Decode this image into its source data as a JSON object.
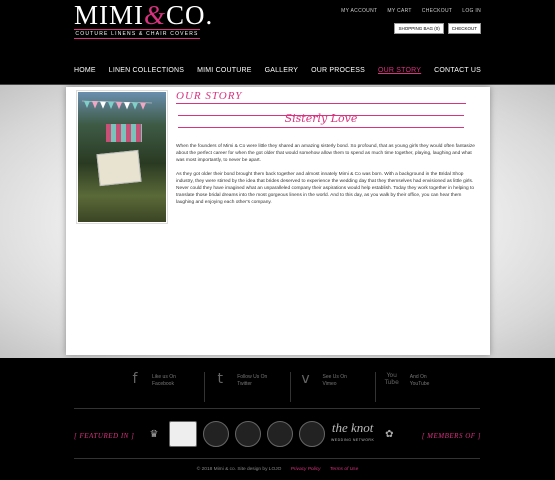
{
  "brand": {
    "name_left": "MIMI",
    "name_amp": "&",
    "name_right": "CO.",
    "tagline": "COUTURE LINENS & CHAIR COVERS"
  },
  "top_links": [
    "MY ACCOUNT",
    "MY CART",
    "CHECKOUT",
    "LOG IN"
  ],
  "cart": {
    "shopping_bag": "SHOPPING BAG (0)",
    "checkout": "CHECKOUT"
  },
  "nav": [
    {
      "label": "HOME",
      "active": false
    },
    {
      "label": "LINEN COLLECTIONS",
      "active": false
    },
    {
      "label": "MIMI COUTURE",
      "active": false
    },
    {
      "label": "GALLERY",
      "active": false
    },
    {
      "label": "OUR PROCESS",
      "active": false
    },
    {
      "label": "OUR STORY",
      "active": true
    },
    {
      "label": "CONTACT US",
      "active": false
    }
  ],
  "page": {
    "title": "OUR STORY",
    "banner": "Sisterly Love",
    "paragraphs": [
      "When the founders of Mimi & Co were little they shared an amazing sisterly bond. So profound, that as young girls they would often fantasize about the perfect career for when the got older that would somehow allow them to spend as much time together, playing, laughing and what was most importantly, to never be apart.",
      "As they got older their bond brought them back together and almost innately Mimi & Co was born. With a background in the Bridal Shop industry, they were stirred by the idea that brides deserved to experience the wedding day that they themselves had envisioned as little girls. Never could they have imagined what an unparalleled company their aspirations would help establish. Today they work together in helping to translate those bridal dreams into the most gorgeous linens in the world. And to this day, as you walk by their office, you can hear them laughing and enjoying each other's company."
    ]
  },
  "social": [
    {
      "icon": "facebook-icon",
      "glyph": "f",
      "line1": "Like us On",
      "line2": "Facebook"
    },
    {
      "icon": "twitter-icon",
      "glyph": "t",
      "line1": "Follow Us On",
      "line2": "Twitter"
    },
    {
      "icon": "vimeo-icon",
      "glyph": "v",
      "line1": "See Us On",
      "line2": "Vimeo"
    },
    {
      "icon": "youtube-icon",
      "glyph": "You Tube",
      "line1": "And On",
      "line2": "YouTube"
    }
  ],
  "footer": {
    "featured_in": "[ FEATURED IN ]",
    "members_of": "[ MEMBERS OF ]",
    "knot": "the knot",
    "knot_sub": "WEDDING NETWORK",
    "copyright": "© 2018 Mimi & co. Site design by LOJO",
    "privacy": "Privacy Policy",
    "terms": "Terms of Use"
  },
  "colors": {
    "accent": "#d9327f",
    "background": "#000000"
  }
}
